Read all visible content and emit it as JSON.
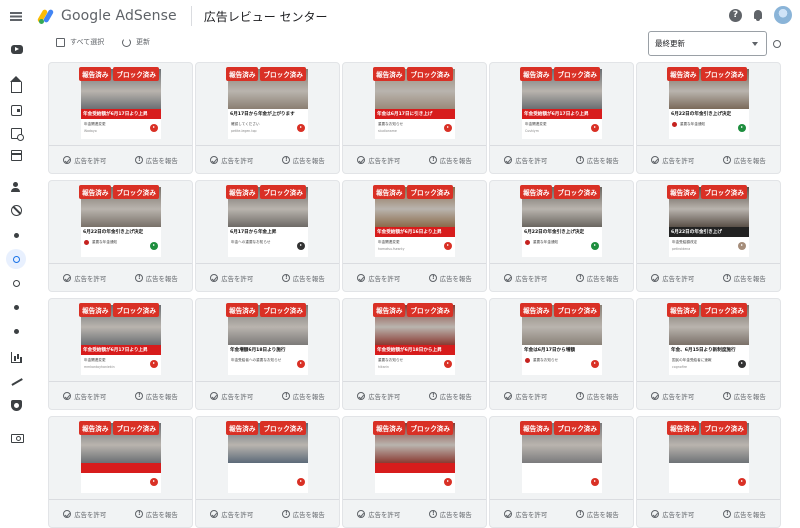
{
  "header": {
    "logo_text": "Google AdSense",
    "page_title": "広告レビュー センター"
  },
  "toolbar": {
    "select_all": "すべて選択",
    "refresh": "更新",
    "sort_value": "最終更新"
  },
  "card_labels": {
    "reported": "報告済み",
    "blocked": "ブロック済み",
    "allow": "広告を許可",
    "report": "広告を報告"
  },
  "cards": [
    {
      "headline": "年金受給額が6月17日より上昇",
      "style": "red",
      "sub": "年金関連変更",
      "domain": "Wadayo",
      "photo": "#6b6f73",
      "cta": "red",
      "flag": false
    },
    {
      "headline": "6月17日から年金が上がります",
      "style": "white",
      "sub": "確認してください",
      "domain": "petite-legen.top",
      "photo": "#8a7e72",
      "cta": "red",
      "flag": false
    },
    {
      "headline": "年金は6月17日に引き上げ",
      "style": "red",
      "sub": "重要なお知らせ",
      "domain": "studioname",
      "photo": "#9a8a7a",
      "cta": "red",
      "flag": false
    },
    {
      "headline": "年金受給額が6月17日より上昇",
      "style": "red",
      "sub": "年金関連変更",
      "domain": "Cushiym",
      "photo": "#6a6e72",
      "cta": "red",
      "flag": false
    },
    {
      "headline": "6月22日の年金引き上げ決定",
      "style": "white",
      "sub": "重要な年金通知",
      "domain": "",
      "photo": "#7a6a5a",
      "cta": "green",
      "flag": true
    },
    {
      "headline": "6月22日の年金引き上げ決定",
      "style": "white",
      "sub": "重要な年金通知",
      "domain": "",
      "photo": "#787068",
      "cta": "green",
      "flag": true
    },
    {
      "headline": "6月17日から年金上昇",
      "style": "white",
      "sub": "年金への重要なお知らせ",
      "domain": "",
      "photo": "#6e6a66",
      "cta": "dark",
      "flag": false
    },
    {
      "headline": "年金受給額が6月16日より上昇",
      "style": "red",
      "sub": "年金関連変更",
      "domain": "hamatsu.fsesnty",
      "photo": "#8a6a4a",
      "cta": "red",
      "flag": false
    },
    {
      "headline": "6月22日の年金引き上げ決定",
      "style": "white",
      "sub": "重要な年金通知",
      "domain": "",
      "photo": "#6a6660",
      "cta": "green",
      "flag": true
    },
    {
      "headline": "6月22日の年金引き上げ",
      "style": "dark",
      "sub": "年金受給額改定",
      "domain": "petiroldena",
      "photo": "#5a5048",
      "cta": "tan",
      "flag": false
    },
    {
      "headline": "年金受給額が6月17日より上昇",
      "style": "red",
      "sub": "年金関連変更",
      "domain": "mmkontoyhaniekin",
      "photo": "#6b6f73",
      "cta": "red",
      "flag": false
    },
    {
      "headline": "年金増額6月18日より施行",
      "style": "white",
      "sub": "年金受給者への重要なお知らせ",
      "domain": "",
      "photo": "#7c7a78",
      "cta": "red",
      "flag": false
    },
    {
      "headline": "年金受給額が6月18日から上昇",
      "style": "red",
      "sub": "重要なお知らせ",
      "domain": "hikarin",
      "photo": "#8a3a32",
      "cta": "red",
      "flag": false
    },
    {
      "headline": "年金は6月17日から増額",
      "style": "white",
      "sub": "重要なお知らせ",
      "domain": "",
      "photo": "#8a8278",
      "cta": "red",
      "flag": true
    },
    {
      "headline": "年金、6月15日より新制度施行",
      "style": "white",
      "sub": "国民の年金受給者に速報",
      "domain": "cognofire",
      "photo": "#7a7068",
      "cta": "dark",
      "flag": false
    },
    {
      "headline": "",
      "style": "red",
      "sub": "",
      "domain": "",
      "photo": "#6b6f73",
      "cta": "red",
      "flag": false
    },
    {
      "headline": "",
      "style": "white",
      "sub": "",
      "domain": "",
      "photo": "#5c6a78",
      "cta": "red",
      "flag": false
    },
    {
      "headline": "",
      "style": "red",
      "sub": "",
      "domain": "",
      "photo": "#8a3a32",
      "cta": "red",
      "flag": false
    },
    {
      "headline": "",
      "style": "white",
      "sub": "",
      "domain": "",
      "photo": "#7a7a7c",
      "cta": "red",
      "flag": false
    },
    {
      "headline": "",
      "style": "white",
      "sub": "",
      "domain": "",
      "photo": "#6e7276",
      "cta": "red",
      "flag": false
    }
  ],
  "colors": {
    "badge_red": "#d93025",
    "accent_blue": "#1a73e8"
  }
}
